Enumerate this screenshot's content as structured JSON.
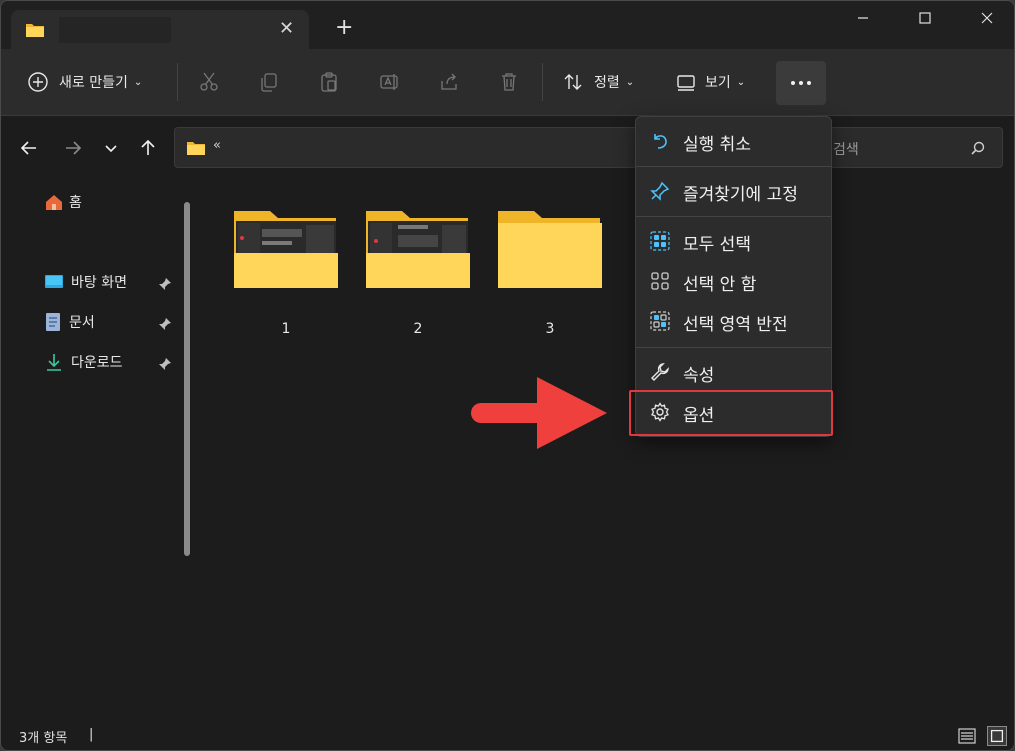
{
  "tab": {
    "title": ""
  },
  "toolbar": {
    "new_label": "새로 만들기",
    "sort_label": "정렬",
    "view_label": "보기"
  },
  "address": {
    "path": "«"
  },
  "search": {
    "placeholder": "검색"
  },
  "sidebar": {
    "home": "홈",
    "items": [
      {
        "label": "바탕 화면",
        "icon": "desktop-icon"
      },
      {
        "label": "문서",
        "icon": "document-icon"
      },
      {
        "label": "다운로드",
        "icon": "download-icon"
      }
    ]
  },
  "folders": [
    {
      "name": "1"
    },
    {
      "name": "2"
    },
    {
      "name": "3"
    }
  ],
  "status": {
    "item_count": "3개 항목"
  },
  "menu": {
    "items": [
      {
        "label": "실행 취소",
        "icon": "undo-icon"
      },
      {
        "label": "즐겨찾기에 고정",
        "icon": "pin-icon"
      },
      {
        "label": "모두 선택",
        "icon": "select-all-icon"
      },
      {
        "label": "선택 안 함",
        "icon": "select-none-icon"
      },
      {
        "label": "선택 영역 반전",
        "icon": "invert-selection-icon"
      },
      {
        "label": "속성",
        "icon": "properties-icon"
      },
      {
        "label": "옵션",
        "icon": "gear-icon"
      }
    ]
  },
  "colors": {
    "accent": "#4cc2ff",
    "highlight": "#e0383e",
    "folder": "#f7c948"
  }
}
